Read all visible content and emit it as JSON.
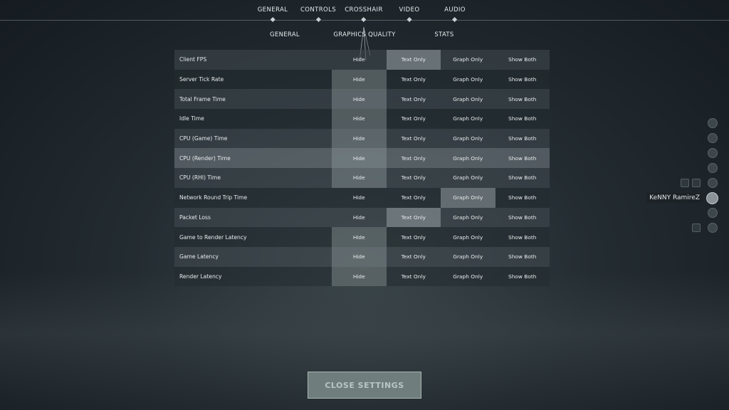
{
  "top_tabs": [
    "GENERAL",
    "CONTROLS",
    "CROSSHAIR",
    "VIDEO",
    "AUDIO"
  ],
  "sub_tabs": [
    "GENERAL",
    "GRAPHICS QUALITY",
    "STATS"
  ],
  "stats": {
    "rows": [
      {
        "label": "Client FPS",
        "options": [
          "Hide",
          "Text Only",
          "Graph Only",
          "Show Both"
        ]
      },
      {
        "label": "Server Tick Rate",
        "options": [
          "Hide",
          "Text Only",
          "Graph Only",
          "Show Both"
        ]
      },
      {
        "label": "Total Frame Time",
        "options": [
          "Hide",
          "Text Only",
          "Graph Only",
          "Show Both"
        ]
      },
      {
        "label": "Idle Time",
        "options": [
          "Hide",
          "Text Only",
          "Graph Only",
          "Show Both"
        ]
      },
      {
        "label": "CPU (Game) Time",
        "options": [
          "Hide",
          "Text Only",
          "Graph Only",
          "Show Both"
        ]
      },
      {
        "label": "CPU (Render) Time",
        "options": [
          "Hide",
          "Text Only",
          "Graph Only",
          "Show Both"
        ]
      },
      {
        "label": "CPU (RHI) Time",
        "options": [
          "Hide",
          "Text Only",
          "Graph Only",
          "Show Both"
        ]
      },
      {
        "label": "Network Round Trip Time",
        "options": [
          "Hide",
          "Text Only",
          "Graph Only",
          "Show Both"
        ]
      },
      {
        "label": "Packet Loss",
        "options": [
          "Hide",
          "Text Only",
          "Graph Only",
          "Show Both"
        ]
      },
      {
        "label": "Game to Render Latency",
        "options": [
          "Hide",
          "Text Only",
          "Graph Only",
          "Show Both"
        ]
      },
      {
        "label": "Game Latency",
        "options": [
          "Hide",
          "Text Only",
          "Graph Only",
          "Show Both"
        ]
      },
      {
        "label": "Render Latency",
        "options": [
          "Hide",
          "Text Only",
          "Graph Only",
          "Show Both"
        ]
      }
    ],
    "selected": [
      "Text Only",
      "Hide",
      "Hide",
      "Hide",
      "Hide",
      "Hide",
      "Hide",
      "Graph Only",
      "Text Only",
      "Hide",
      "Hide",
      "Hide"
    ]
  },
  "close_button": "CLOSE SETTINGS",
  "social": {
    "player_name": "KeNNY RamireZ"
  }
}
